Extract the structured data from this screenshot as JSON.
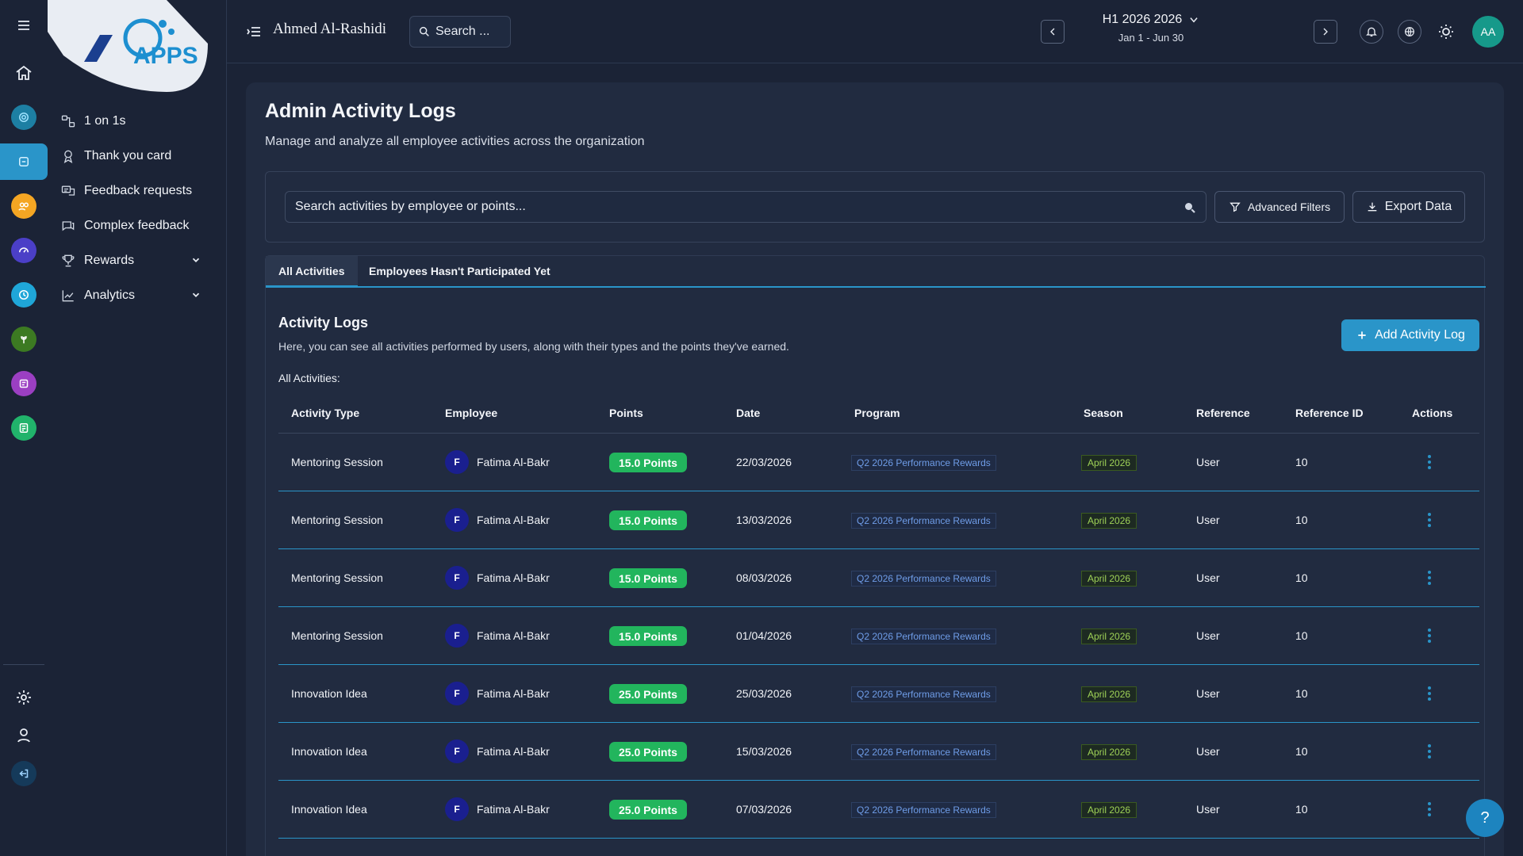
{
  "app": {
    "logo_text": "APPS",
    "user_name": "Ahmed Al-Rashidi",
    "search_label": "Search ...",
    "period_title": "H1 2026 2026",
    "period_range": "Jan 1 - Jun 30",
    "avatar_initials": "AA",
    "accent_color": "#2a95c9"
  },
  "sidebar": {
    "items": [
      {
        "label": "1 on 1s",
        "icon": "one-on-one-icon"
      },
      {
        "label": "Thank you card",
        "icon": "thank-you-icon"
      },
      {
        "label": "Feedback requests",
        "icon": "feedback-request-icon"
      },
      {
        "label": "Complex feedback",
        "icon": "complex-feedback-icon"
      },
      {
        "label": "Rewards",
        "icon": "trophy-icon"
      },
      {
        "label": "Analytics",
        "icon": "chart-line-icon"
      }
    ]
  },
  "page": {
    "title": "Admin Activity Logs",
    "subtitle": "Manage and analyze all employee activities across the organization",
    "search_placeholder": "Search activities by employee or points...",
    "advanced_filters": "Advanced Filters",
    "export_data": "Export Data"
  },
  "tabs": [
    {
      "label": "All Activities",
      "active": true
    },
    {
      "label": "Employees Hasn't Participated Yet",
      "active": false
    }
  ],
  "logs": {
    "title": "Activity Logs",
    "subtitle": "Here, you can see all activities performed by users, along with their types and the points they've earned.",
    "add_button": "Add Activity Log",
    "all_label": "All Activities:",
    "columns": [
      "Activity Type",
      "Employee",
      "Points",
      "Date",
      "Program",
      "Season",
      "Reference",
      "Reference ID",
      "Actions"
    ],
    "rows": [
      {
        "type": "Mentoring Session",
        "initial": "F",
        "employee": "Fatima Al-Bakr",
        "points": "15.0 Points",
        "date": "22/03/2026",
        "program": "Q2 2026 Performance Rewards",
        "season": "April 2026",
        "reference": "User",
        "ref_id": "10"
      },
      {
        "type": "Mentoring Session",
        "initial": "F",
        "employee": "Fatima Al-Bakr",
        "points": "15.0 Points",
        "date": "13/03/2026",
        "program": "Q2 2026 Performance Rewards",
        "season": "April 2026",
        "reference": "User",
        "ref_id": "10"
      },
      {
        "type": "Mentoring Session",
        "initial": "F",
        "employee": "Fatima Al-Bakr",
        "points": "15.0 Points",
        "date": "08/03/2026",
        "program": "Q2 2026 Performance Rewards",
        "season": "April 2026",
        "reference": "User",
        "ref_id": "10"
      },
      {
        "type": "Mentoring Session",
        "initial": "F",
        "employee": "Fatima Al-Bakr",
        "points": "15.0 Points",
        "date": "01/04/2026",
        "program": "Q2 2026 Performance Rewards",
        "season": "April 2026",
        "reference": "User",
        "ref_id": "10"
      },
      {
        "type": "Innovation Idea",
        "initial": "F",
        "employee": "Fatima Al-Bakr",
        "points": "25.0 Points",
        "date": "25/03/2026",
        "program": "Q2 2026 Performance Rewards",
        "season": "April 2026",
        "reference": "User",
        "ref_id": "10"
      },
      {
        "type": "Innovation Idea",
        "initial": "F",
        "employee": "Fatima Al-Bakr",
        "points": "25.0 Points",
        "date": "15/03/2026",
        "program": "Q2 2026 Performance Rewards",
        "season": "April 2026",
        "reference": "User",
        "ref_id": "10"
      },
      {
        "type": "Innovation Idea",
        "initial": "F",
        "employee": "Fatima Al-Bakr",
        "points": "25.0 Points",
        "date": "07/03/2026",
        "program": "Q2 2026 Performance Rewards",
        "season": "April 2026",
        "reference": "User",
        "ref_id": "10"
      }
    ]
  },
  "help_label": "?"
}
